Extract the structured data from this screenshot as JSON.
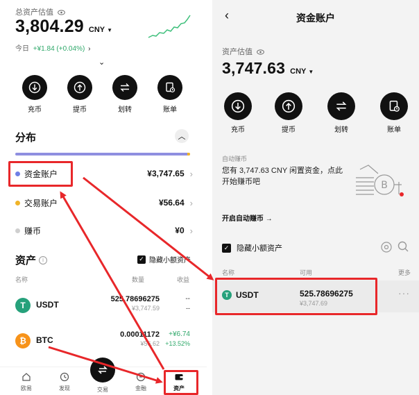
{
  "left": {
    "total_label": "总资产估值",
    "total_value": "3,804.29",
    "currency": "CNY",
    "today_label": "今日",
    "today_change": "+¥1.84 (+0.04%)",
    "actions": [
      {
        "label": "充币",
        "icon": "deposit-icon"
      },
      {
        "label": "提币",
        "icon": "withdraw-icon"
      },
      {
        "label": "划转",
        "icon": "transfer-icon"
      },
      {
        "label": "账单",
        "icon": "bill-icon"
      }
    ],
    "distribution_title": "分布",
    "accounts": [
      {
        "name": "资金账户",
        "amount": "¥3,747.65",
        "color": "#6f7fe6"
      },
      {
        "name": "交易账户",
        "amount": "¥56.64",
        "color": "#f0b429"
      },
      {
        "name": "赚币",
        "amount": "¥0",
        "color": "#cfcfcf"
      }
    ],
    "assets_title": "资产",
    "hide_small_label": "隐藏小额资产",
    "columns": {
      "name": "名称",
      "qty": "数量",
      "pnl": "收益"
    },
    "assets": [
      {
        "symbol": "USDT",
        "qty": "525.78696275",
        "cny": "¥3,747.59",
        "pnl": "--",
        "pnl_pct": "--",
        "color": "#26a17b",
        "glyph": "T"
      },
      {
        "symbol": "BTC",
        "qty": "0.00011172",
        "cny": "¥56.62",
        "pnl": "+¥6.74",
        "pnl_pct": "+13.52%",
        "color": "#f7931a",
        "glyph": "₿"
      }
    ],
    "tabs": [
      {
        "label": "欧易",
        "icon": "home-icon"
      },
      {
        "label": "发现",
        "icon": "discover-icon"
      },
      {
        "label": "交易",
        "icon": "trade-icon"
      },
      {
        "label": "金融",
        "icon": "finance-icon"
      },
      {
        "label": "资产",
        "icon": "wallet-icon"
      }
    ]
  },
  "right": {
    "title": "资金账户",
    "estimate_label": "资产估值",
    "estimate_value": "3,747.63",
    "currency": "CNY",
    "actions": [
      {
        "label": "充币",
        "icon": "deposit-icon"
      },
      {
        "label": "提币",
        "icon": "withdraw-icon"
      },
      {
        "label": "划转",
        "icon": "transfer-icon"
      },
      {
        "label": "账单",
        "icon": "bill-icon"
      }
    ],
    "auto_earn_label": "自动赚币",
    "promo_text": "您有 3,747.63 CNY 闲置资金，点此开始赚币吧",
    "enable_link": "开启自动赚币 →",
    "hide_small_label": "隐藏小额资产",
    "columns": {
      "name": "名称",
      "available": "可用",
      "more": "更多"
    },
    "asset": {
      "symbol": "USDT",
      "qty": "525.78696275",
      "cny": "¥3,747.69",
      "color": "#26a17b",
      "glyph": "T"
    }
  }
}
